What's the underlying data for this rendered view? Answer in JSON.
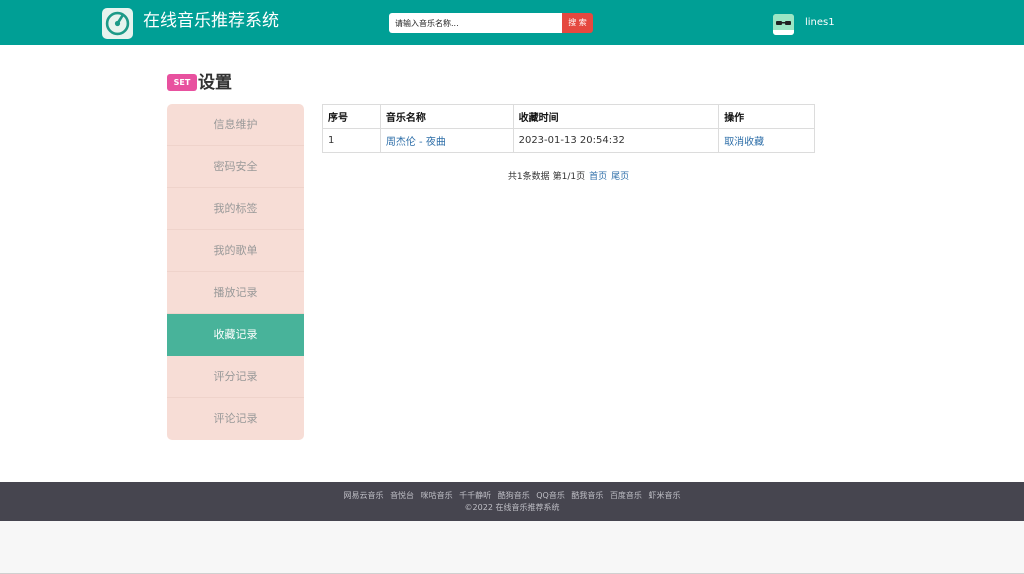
{
  "header": {
    "app_title": "在线音乐推荐系统",
    "search_placeholder": "请输入音乐名称...",
    "search_button": "搜 索",
    "username": "lines1",
    "bg_color": "#009f95"
  },
  "page": {
    "badge": "SET",
    "title": "设置"
  },
  "sidebar": {
    "items": [
      {
        "label": "信息维护"
      },
      {
        "label": "密码安全"
      },
      {
        "label": "我的标签"
      },
      {
        "label": "我的歌单"
      },
      {
        "label": "播放记录"
      },
      {
        "label": "收藏记录",
        "active": true
      },
      {
        "label": "评分记录"
      },
      {
        "label": "评论记录"
      }
    ],
    "active_color": "#48b39a"
  },
  "table": {
    "headers": [
      "序号",
      "音乐名称",
      "收藏时间",
      "操作"
    ],
    "rows": [
      {
        "index": "1",
        "music": "周杰伦 - 夜曲",
        "time": "2023-01-13 20:54:32",
        "action": "取消收藏"
      }
    ]
  },
  "pagination": {
    "summary": "共1条数据",
    "page_info": "第1/1页",
    "first": "首页",
    "last": "尾页"
  },
  "footer": {
    "links": [
      "网易云音乐",
      "音悦台",
      "咪咕音乐",
      "千千静听",
      "酷狗音乐",
      "QQ音乐",
      "酷我音乐",
      "百度音乐",
      "虾米音乐"
    ],
    "copyright": "©2022 在线音乐推荐系统"
  }
}
